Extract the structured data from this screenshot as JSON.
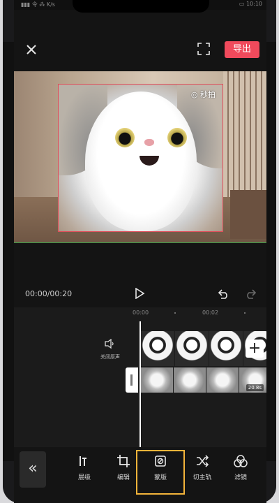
{
  "status": {
    "left": "▮▮▮ 令 ⁂ K/s",
    "right": "▭ 10:10"
  },
  "header": {
    "close_icon": "close-icon",
    "fullscreen_icon": "fullscreen-icon",
    "export_label": "导出",
    "accent": "#f04a5c"
  },
  "preview": {
    "watermark": "◎ 秒拍"
  },
  "playback": {
    "time": "00:00/00:20"
  },
  "timeline": {
    "ruler": [
      "00:00",
      "00:02"
    ],
    "mute_label": "关闭原声",
    "duration": "20.8s"
  },
  "toolbar": {
    "back": "«",
    "tools": [
      {
        "label": "层级",
        "icon": "layer-icon"
      },
      {
        "label": "编辑",
        "icon": "crop-icon"
      },
      {
        "label": "蒙版",
        "icon": "mask-icon"
      },
      {
        "label": "切主轨",
        "icon": "shuffle-icon"
      },
      {
        "label": "滤镜",
        "icon": "filter-icon"
      }
    ],
    "highlight_color": "#f4b43a"
  }
}
